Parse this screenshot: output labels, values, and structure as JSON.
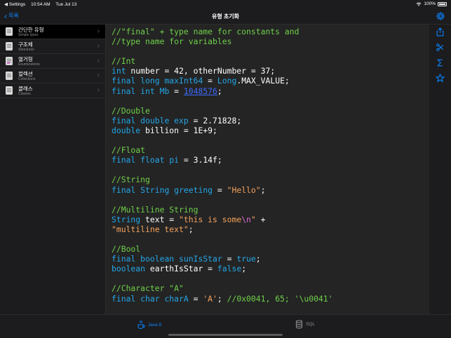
{
  "status_bar": {
    "back_app": "◀ Settings",
    "time": "10:54 AM",
    "date": "Tue Jul 13",
    "battery": "100%"
  },
  "nav": {
    "back_label": "목록",
    "title": "유형 초기화"
  },
  "sidebar": {
    "items": [
      {
        "title": "간단한 유형",
        "subtitle": "Simple types",
        "selected": true
      },
      {
        "title": "구조체",
        "subtitle": "Structures",
        "selected": false
      },
      {
        "title": "열거형",
        "subtitle": "Enumerations",
        "selected": false
      },
      {
        "title": "컬렉션",
        "subtitle": "Collections",
        "selected": false
      },
      {
        "title": "클래스",
        "subtitle": "Classes",
        "selected": false
      }
    ]
  },
  "code": {
    "language": "Java",
    "lines": [
      [
        {
          "t": "//\"final\" + type name for constants and",
          "c": "cm"
        }
      ],
      [
        {
          "t": "//type name for variables",
          "c": "cm"
        }
      ],
      [],
      [
        {
          "t": "//Int",
          "c": "cm"
        }
      ],
      [
        {
          "t": "int",
          "c": "kw"
        },
        {
          "t": " number = 42, otherNumber = 37;",
          "c": ""
        }
      ],
      [
        {
          "t": "final",
          "c": "kw"
        },
        {
          "t": " ",
          "c": ""
        },
        {
          "t": "long",
          "c": "kw"
        },
        {
          "t": " ",
          "c": ""
        },
        {
          "t": "maxInt64",
          "c": "kw"
        },
        {
          "t": " = ",
          "c": ""
        },
        {
          "t": "Long",
          "c": "kw"
        },
        {
          "t": ".MAX_VALUE;",
          "c": ""
        }
      ],
      [
        {
          "t": "final",
          "c": "kw"
        },
        {
          "t": " ",
          "c": ""
        },
        {
          "t": "int",
          "c": "kw"
        },
        {
          "t": " ",
          "c": ""
        },
        {
          "t": "Mb",
          "c": "kw"
        },
        {
          "t": " = ",
          "c": ""
        },
        {
          "t": "1048576",
          "c": "ln"
        },
        {
          "t": ";",
          "c": ""
        }
      ],
      [],
      [
        {
          "t": "//Double",
          "c": "cm"
        }
      ],
      [
        {
          "t": "final",
          "c": "kw"
        },
        {
          "t": " ",
          "c": ""
        },
        {
          "t": "double",
          "c": "kw"
        },
        {
          "t": " ",
          "c": ""
        },
        {
          "t": "exp",
          "c": "kw"
        },
        {
          "t": " = 2.71828;",
          "c": ""
        }
      ],
      [
        {
          "t": "double",
          "c": "kw"
        },
        {
          "t": " billion = 1E+9;",
          "c": ""
        }
      ],
      [],
      [
        {
          "t": "//Float",
          "c": "cm"
        }
      ],
      [
        {
          "t": "final",
          "c": "kw"
        },
        {
          "t": " ",
          "c": ""
        },
        {
          "t": "float",
          "c": "kw"
        },
        {
          "t": " ",
          "c": ""
        },
        {
          "t": "pi",
          "c": "kw"
        },
        {
          "t": " = 3.14f;",
          "c": ""
        }
      ],
      [],
      [
        {
          "t": "//String",
          "c": "cm"
        }
      ],
      [
        {
          "t": "final",
          "c": "kw"
        },
        {
          "t": " ",
          "c": ""
        },
        {
          "t": "String",
          "c": "kw"
        },
        {
          "t": " ",
          "c": ""
        },
        {
          "t": "greeting",
          "c": "kw"
        },
        {
          "t": " = ",
          "c": ""
        },
        {
          "t": "\"Hello\"",
          "c": "st"
        },
        {
          "t": ";",
          "c": ""
        }
      ],
      [],
      [
        {
          "t": "//Multiline String",
          "c": "cm"
        }
      ],
      [
        {
          "t": "String",
          "c": "kw"
        },
        {
          "t": " text = ",
          "c": ""
        },
        {
          "t": "\"this is some",
          "c": "st"
        },
        {
          "t": "\\n",
          "c": "es"
        },
        {
          "t": "\"",
          "c": "st"
        },
        {
          "t": " +",
          "c": ""
        }
      ],
      [
        {
          "t": "\"multiline text\"",
          "c": "st"
        },
        {
          "t": ";",
          "c": ""
        }
      ],
      [],
      [
        {
          "t": "//Bool",
          "c": "cm"
        }
      ],
      [
        {
          "t": "final",
          "c": "kw"
        },
        {
          "t": " ",
          "c": ""
        },
        {
          "t": "boolean",
          "c": "kw"
        },
        {
          "t": " ",
          "c": ""
        },
        {
          "t": "sunIsStar",
          "c": "kw"
        },
        {
          "t": " = ",
          "c": ""
        },
        {
          "t": "true",
          "c": "kw"
        },
        {
          "t": ";",
          "c": ""
        }
      ],
      [
        {
          "t": "boolean",
          "c": "kw"
        },
        {
          "t": " earthIsStar = ",
          "c": ""
        },
        {
          "t": "false",
          "c": "kw"
        },
        {
          "t": ";",
          "c": ""
        }
      ],
      [],
      [
        {
          "t": "//Character \"A\"",
          "c": "cm"
        }
      ],
      [
        {
          "t": "final",
          "c": "kw"
        },
        {
          "t": " ",
          "c": ""
        },
        {
          "t": "char",
          "c": "kw"
        },
        {
          "t": " ",
          "c": ""
        },
        {
          "t": "charA",
          "c": "kw"
        },
        {
          "t": " = ",
          "c": ""
        },
        {
          "t": "'A'",
          "c": "ch"
        },
        {
          "t": "; ",
          "c": ""
        },
        {
          "t": "//0x0041, 65; '\\u0041'",
          "c": "cm"
        }
      ]
    ]
  },
  "toolbar": {
    "icons": [
      "share-icon",
      "scissors-icon",
      "sigma-icon",
      "star-icon"
    ]
  },
  "tabs": [
    {
      "label": "Java 8",
      "icon": "coffee-cup-icon",
      "active": true
    },
    {
      "label": "SQL",
      "icon": "database-icon",
      "active": false
    }
  ],
  "colors": {
    "accent": "#0a84ff",
    "comment": "#6fd04a",
    "keyword": "#23a6e8",
    "string": "#f5a25c",
    "code_bg": "#242424"
  }
}
